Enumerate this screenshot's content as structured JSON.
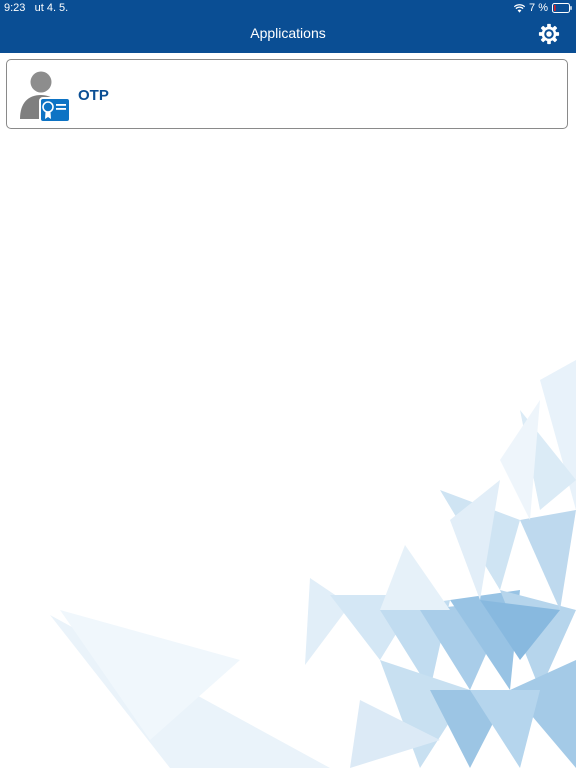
{
  "status_bar": {
    "time": "9:23",
    "date": "ut 4. 5.",
    "battery": "7 %"
  },
  "nav": {
    "title": "Applications",
    "settings_icon": "gear-icon"
  },
  "apps": [
    {
      "label": "OTP",
      "icon": "user-certificate-icon"
    }
  ],
  "colors": {
    "header": "#0a4e94",
    "accent": "#0a4e94",
    "background": "#ffffff"
  }
}
